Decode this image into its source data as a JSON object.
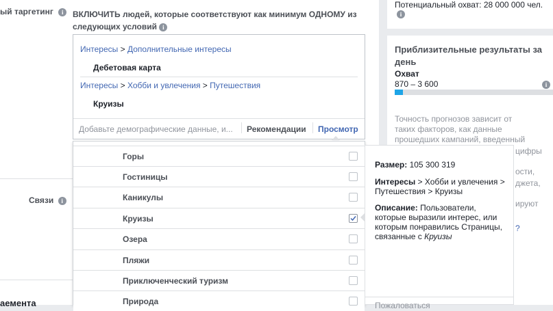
{
  "left": {
    "targeting_label": "ый таргетинг",
    "include_heading": "ВКЛЮЧИТЬ людей, которые соответствуют как минимум ОДНОМУ из следующих условий",
    "group1": {
      "path": [
        "Интересы",
        "Дополнительные интересы"
      ],
      "item": "Дебетовая карта"
    },
    "group2": {
      "path": [
        "Интересы",
        "Хобби и увлечения",
        "Путешествия"
      ],
      "item": "Круизы"
    },
    "search_placeholder": "Добавьте демографические данные, и...",
    "recommendations": "Рекомендации",
    "browse": "Просмотр",
    "connections_label": "Связи",
    "bottom_cut_label": "аемента"
  },
  "dropdown": {
    "items": [
      {
        "label": "Горы",
        "checked": false
      },
      {
        "label": "Гостиницы",
        "checked": false
      },
      {
        "label": "Каникулы",
        "checked": false
      },
      {
        "label": "Круизы",
        "checked": true
      },
      {
        "label": "Озера",
        "checked": false
      },
      {
        "label": "Пляжи",
        "checked": false
      },
      {
        "label": "Приключенческий туризм",
        "checked": false
      },
      {
        "label": "Природа",
        "checked": false
      }
    ]
  },
  "tooltip": {
    "size_label": "Размер:",
    "size_value": "105 300 319",
    "interests_label": "Интересы",
    "interests_path": "> Хобби и увлечения > Путешествия > Круизы",
    "desc_label": "Описание:",
    "desc_text": "Пользователи, которые выразили интерес, или которым понравились Страницы, связанные с",
    "desc_italic": "Круизы",
    "bottom_cut": "Пожаловаться"
  },
  "right": {
    "potential_reach": "Потенциальный охват: 28 000 000 чел.",
    "daily_title": "Приблизительные результаты за день",
    "reach_label": "Охват",
    "reach_range": "870 – 3 600",
    "reach_fill": 0.05,
    "accuracy_text": "Точность прогнозов зависит от таких факторов, как данные прошедших кампаний, введенный бюджет",
    "cut_right_1": "цифры",
    "cut_right_2": "ости,",
    "cut_right_3": "джета,",
    "cut_right_4": "ируют",
    "cut_right_5": "?"
  },
  "colors": {
    "link": "#4267b2",
    "fill": "#1ea5e7",
    "bg": "#e9ebee"
  }
}
